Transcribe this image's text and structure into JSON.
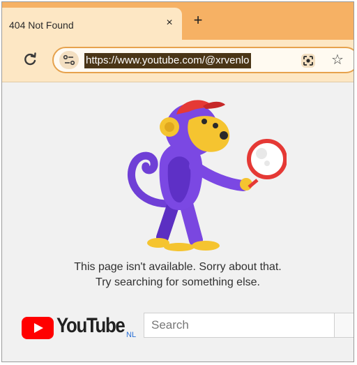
{
  "browser": {
    "tab": {
      "title": "404 Not Found",
      "close_symbol": "×"
    },
    "new_tab_symbol": "+",
    "address_bar": {
      "url": "https://www.youtube.com/@xrvenlo"
    },
    "bookmark_symbol": "☆",
    "colors": {
      "tabstrip": "#f6b164",
      "toolbar": "#fde7c4",
      "url_highlight": "#4a3516"
    }
  },
  "page": {
    "illustration": "monkey-with-magnifier",
    "message_line1": "This page isn't available. Sorry about that.",
    "message_line2": "Try searching for something else.",
    "logo": {
      "wordmark": "YouTube",
      "region": "NL",
      "brand_color": "#ff0000"
    },
    "search": {
      "placeholder": "Search"
    }
  }
}
